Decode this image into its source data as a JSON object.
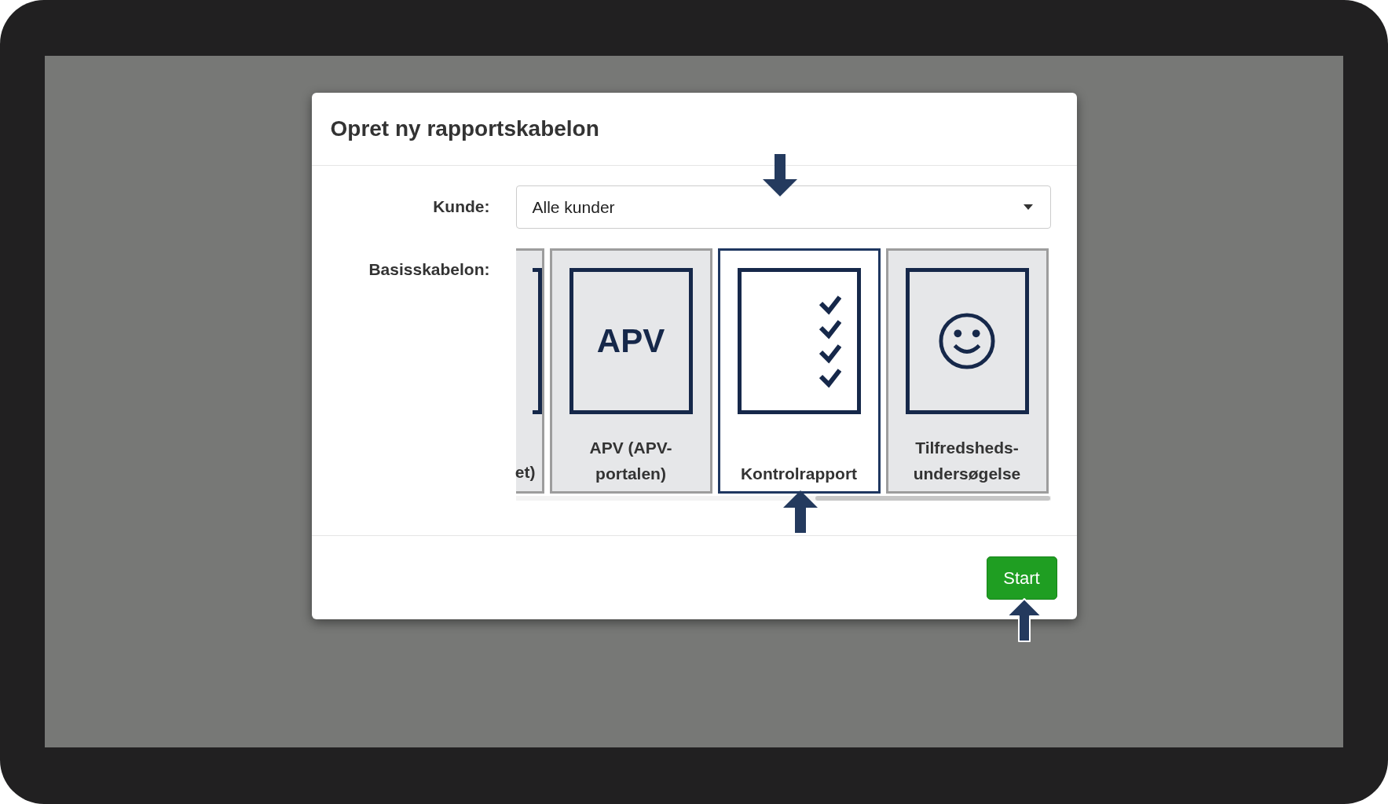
{
  "dialog": {
    "title": "Opret ny rapportskabelon"
  },
  "customer": {
    "label": "Kunde:",
    "value": "Alle kunder"
  },
  "templates_label": "Basisskabelon:",
  "templates": [
    {
      "kind": "partial",
      "label": "et)",
      "selected": false
    },
    {
      "kind": "text",
      "icon_text": "APV",
      "label": "APV (APV-portalen)",
      "selected": false
    },
    {
      "kind": "checklist",
      "label": "Kontrolrapport",
      "selected": true
    },
    {
      "kind": "smiley",
      "label": "Tilfredsheds-undersøgelse",
      "selected": false
    }
  ],
  "start_button": "Start",
  "callout_arrows": [
    {
      "kind": "down"
    },
    {
      "kind": "up"
    },
    {
      "kind": "up"
    }
  ]
}
